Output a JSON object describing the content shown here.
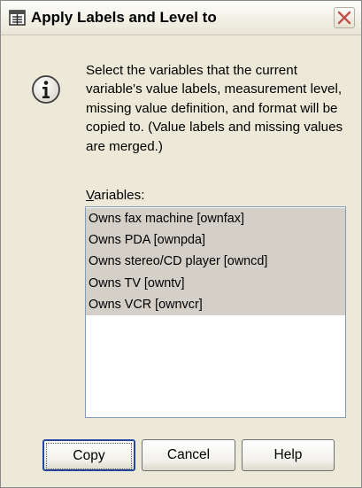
{
  "window": {
    "title": "Apply Labels and Level to",
    "icons": {
      "app": "dialog-app-icon",
      "close": "close-icon",
      "info": "info-icon"
    }
  },
  "message": {
    "text": "Select the variables that the current variable's value labels, measurement level, missing value definition, and format will be copied to. (Value labels and missing values are merged.)"
  },
  "variables": {
    "label_mnemonic": "V",
    "label_rest": "ariables:",
    "items": [
      {
        "label": "Owns fax machine [ownfax]"
      },
      {
        "label": "Owns PDA [ownpda]"
      },
      {
        "label": "Owns stereo/CD player [owncd]"
      },
      {
        "label": "Owns TV [owntv]"
      },
      {
        "label": "Owns VCR [ownvcr]"
      }
    ]
  },
  "buttons": {
    "copy": "Copy",
    "cancel": "Cancel",
    "help": "Help"
  },
  "colors": {
    "dialog_background": "#ece9d8",
    "selected_item": "#d4d0c8",
    "default_button_border": "#26479c",
    "close_x": "#c0504d"
  }
}
